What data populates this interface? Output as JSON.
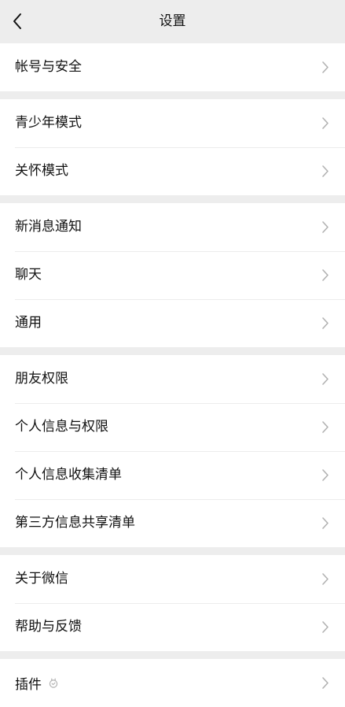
{
  "header": {
    "title": "设置"
  },
  "groups": [
    {
      "items": [
        {
          "label": "帐号与安全"
        }
      ]
    },
    {
      "items": [
        {
          "label": "青少年模式"
        },
        {
          "label": "关怀模式"
        }
      ]
    },
    {
      "items": [
        {
          "label": "新消息通知"
        },
        {
          "label": "聊天"
        },
        {
          "label": "通用"
        }
      ]
    },
    {
      "items": [
        {
          "label": "朋友权限"
        },
        {
          "label": "个人信息与权限"
        },
        {
          "label": "个人信息收集清单"
        },
        {
          "label": "第三方信息共享清单"
        }
      ]
    },
    {
      "items": [
        {
          "label": "关于微信"
        },
        {
          "label": "帮助与反馈"
        }
      ]
    },
    {
      "items": [
        {
          "label": "插件"
        }
      ]
    }
  ],
  "icons": {
    "back": "chevron-left-icon",
    "row_arrow": "chevron-right-icon",
    "plugin": "plugin-icon"
  },
  "colors": {
    "background": "#ededed",
    "card": "#ffffff",
    "text": "#111111",
    "chevron": "#b2b2b2"
  }
}
